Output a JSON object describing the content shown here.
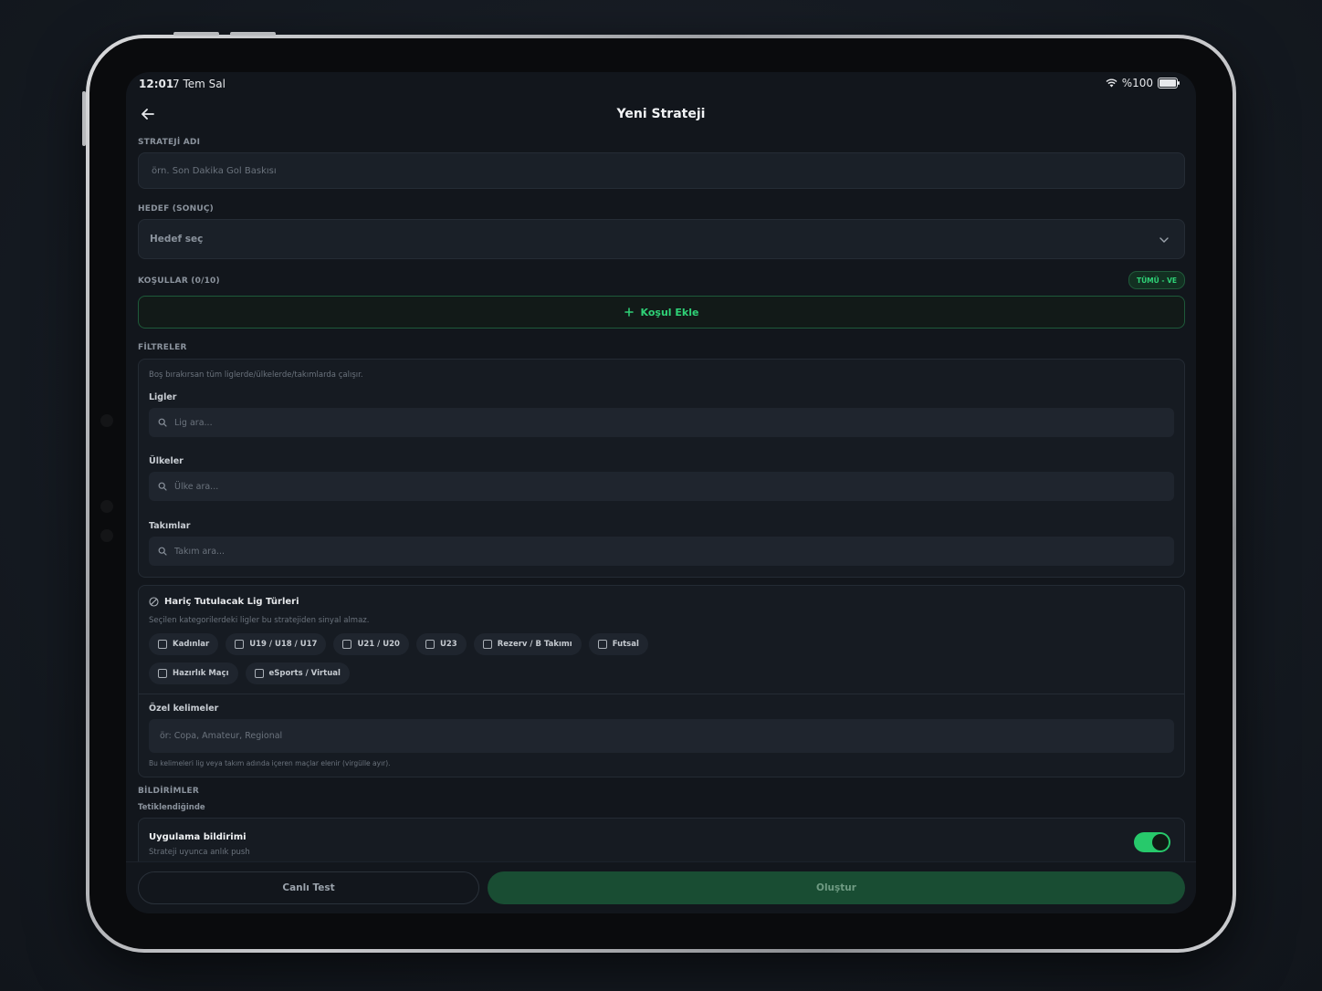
{
  "status_bar": {
    "time": "12:01",
    "date": "7 Tem Sal",
    "battery": "%100"
  },
  "header": {
    "title": "Yeni Strateji"
  },
  "strategy_name": {
    "label": "STRATEJİ ADI",
    "placeholder": "örn. Son Dakika Gol Baskısı"
  },
  "target": {
    "label": "HEDEF (SONUÇ)",
    "value": "Hedef seç"
  },
  "conditions": {
    "label": "KOŞULLAR (0/10)",
    "badge": "TÜMÜ - VE",
    "add_label": "Koşul Ekle"
  },
  "filters": {
    "label": "FİLTRELER",
    "hint": "Boş bırakırsan tüm liglerde/ülkelerde/takımlarda çalışır.",
    "leagues": {
      "label": "Ligler",
      "placeholder": "Lig ara..."
    },
    "countries": {
      "label": "Ülkeler",
      "placeholder": "Ülke ara..."
    },
    "teams": {
      "label": "Takımlar",
      "placeholder": "Takım ara..."
    }
  },
  "excluded": {
    "title": "Hariç Tutulacak Lig Türleri",
    "hint": "Seçilen kategorilerdeki ligler bu stratejiden sinyal almaz.",
    "chips": [
      "Kadınlar",
      "U19 / U18 / U17",
      "U21 / U20",
      "U23",
      "Rezerv / B Takımı",
      "Futsal",
      "Hazırlık Maçı",
      "eSports / Virtual"
    ],
    "keywords_label": "Özel kelimeler",
    "keywords_placeholder": "ör: Copa, Amateur, Regional",
    "keywords_hint": "Bu kelimeleri lig veya takım adında içeren maçlar elenir (virgülle ayır)."
  },
  "notifications": {
    "label": "BİLDİRİMLER",
    "sub_label": "Tetiklendiğinde",
    "app_title": "Uygulama bildirimi",
    "app_desc": "Strateji uyunca anlık push"
  },
  "footer": {
    "test_label": "Canlı Test",
    "create_label": "Oluştur"
  },
  "colors": {
    "accent": "#27c96b",
    "create_bg": "#194d33"
  }
}
